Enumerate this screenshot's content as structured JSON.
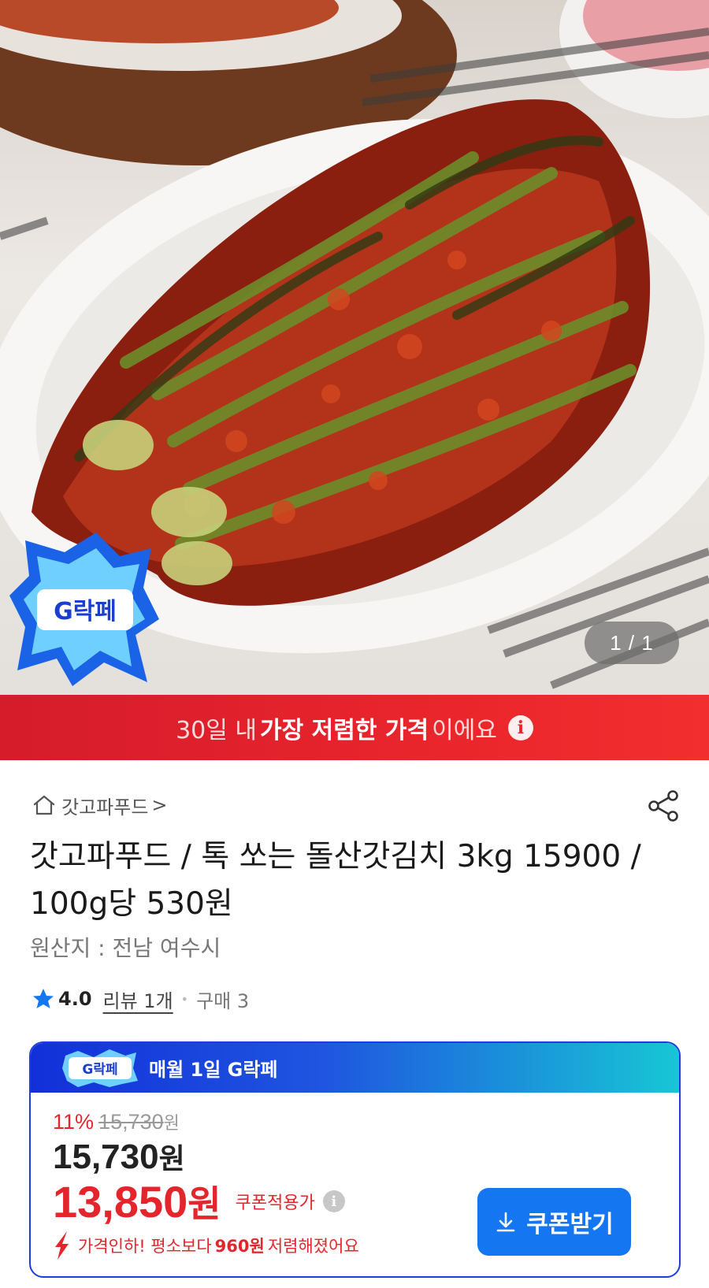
{
  "hero": {
    "image_alt": "갓김치",
    "badge_text": "G락페",
    "counter": "1 / 1"
  },
  "banner": {
    "pre": "30일 내",
    "strong": "가장 저렴한 가격",
    "post": "이에요",
    "info_icon": "i"
  },
  "shop": {
    "name": "갓고파푸드",
    "chevron": ">",
    "icons": [
      "home-icon",
      "share-icon"
    ]
  },
  "product": {
    "title": "갓고파푸드 / 톡 쏘는 돌산갓김치 3kg 15900 / 100g당 530원",
    "origin": "원산지 : 전남 여수시",
    "rating": "4.0",
    "reviews": "리뷰 1개",
    "purchases": "구매 3"
  },
  "promo_card": {
    "header_logo": "G락페",
    "header_text": "매월 1일 G락페",
    "discount_pct": "11%",
    "original_price": "15,730",
    "original_price_unit": "원",
    "price": "15,730",
    "price_unit": "원",
    "coupon_price": "13,850",
    "coupon_price_unit": "원",
    "coupon_label": "쿠폰적용가",
    "drop_pre": "가격인하! 평소보다",
    "drop_amount": "960원",
    "drop_post": "저렴해졌어요",
    "coupon_button": "쿠폰받기"
  },
  "colors": {
    "banner_red": "#e4252c",
    "accent_blue": "#1576f2",
    "card_blue": "#1f3ce0",
    "teal": "#17c6d4"
  }
}
